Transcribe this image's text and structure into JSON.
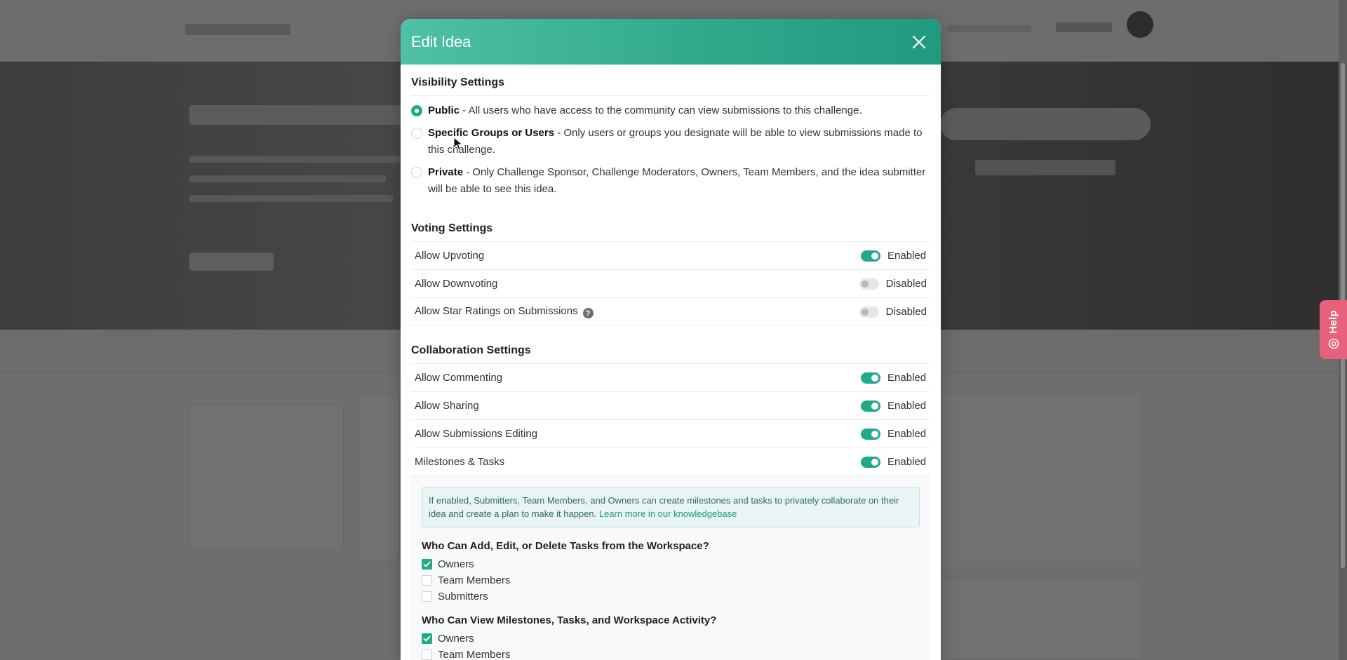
{
  "modal": {
    "title": "Edit Idea",
    "close_label": "×"
  },
  "visibility": {
    "title": "Visibility Settings",
    "options": [
      {
        "name": "Public",
        "description": " - All users who have access to the community can view submissions to this challenge.",
        "selected": true
      },
      {
        "name": "Specific Groups or Users",
        "description": " - Only users or groups you designate will be able to view submissions made to this challenge.",
        "selected": false
      },
      {
        "name": "Private",
        "description": " - Only Challenge Sponsor, Challenge Moderators, Owners, Team Members, and the idea submitter will be able to see this idea.",
        "selected": false
      }
    ]
  },
  "voting": {
    "title": "Voting Settings",
    "rows": [
      {
        "label": "Allow Upvoting",
        "state": "Enabled",
        "on": true
      },
      {
        "label": "Allow Downvoting",
        "state": "Disabled",
        "on": false
      },
      {
        "label": "Allow Star Ratings on Submissions",
        "state": "Disabled",
        "on": false,
        "info_icon": "?"
      }
    ]
  },
  "collaboration": {
    "title": "Collaboration Settings",
    "rows": [
      {
        "label": "Allow Commenting",
        "state": "Enabled",
        "on": true
      },
      {
        "label": "Allow Sharing",
        "state": "Enabled",
        "on": true
      },
      {
        "label": "Allow Submissions Editing",
        "state": "Enabled",
        "on": true
      },
      {
        "label": "Milestones & Tasks",
        "state": "Enabled",
        "on": true
      }
    ],
    "info_text": "If enabled, Submitters, Team Members, and Owners can create milestones and tasks to privately collaborate on their idea and create a plan to make it happen. ",
    "info_link": "Learn more in our knowledgebase",
    "tasks_question": "Who Can Add, Edit, or Delete Tasks from the Workspace?",
    "tasks_options": [
      {
        "label": "Owners",
        "checked": true
      },
      {
        "label": "Team Members",
        "checked": false
      },
      {
        "label": "Submitters",
        "checked": false
      }
    ],
    "view_question": "Who Can View Milestones, Tasks, and Workspace Activity?",
    "view_options": [
      {
        "label": "Owners",
        "checked": true
      },
      {
        "label": "Team Members",
        "checked": false
      }
    ]
  },
  "help_tab": {
    "label": "Help"
  },
  "colors": {
    "accent": "#23a98a",
    "header_start": "#4fc0a5",
    "header_end": "#1f9a80",
    "help": "#e8617c"
  }
}
